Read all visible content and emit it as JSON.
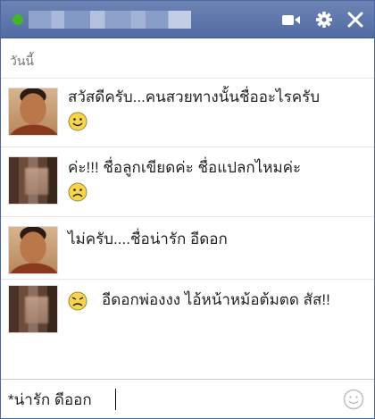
{
  "titlebar": {
    "contact_name": "",
    "online": true,
    "icons": [
      "video-icon",
      "gear-icon",
      "close-icon"
    ]
  },
  "date_divider": "วันนี้",
  "messages": [
    {
      "sender": "man",
      "text": "สวัสดีครับ...คนสวยทางนั้นชื่ออะไรครับ",
      "emoticon": "smile"
    },
    {
      "sender": "woman",
      "text": "ค่ะ!!! ชื่อลูกเขียดค่ะ ชื่อแปลกไหมค่ะ",
      "emoticon": "frown"
    },
    {
      "sender": "man",
      "text": "ไม่ครับ....ชื่อน่ารัก อีดอก",
      "emoticon": ""
    },
    {
      "sender": "woman",
      "text": "อีดอกพ่องงง ไอ้หน้าหม้อต้มตด สัส!!",
      "emoticon": "angry"
    }
  ],
  "composer": {
    "value": "*น่ารัก ดีออก",
    "icon": "emoji-icon"
  },
  "colors": {
    "titlebar": "#516ca3",
    "online": "#42b72a",
    "emoticon": "#f7d44c"
  }
}
